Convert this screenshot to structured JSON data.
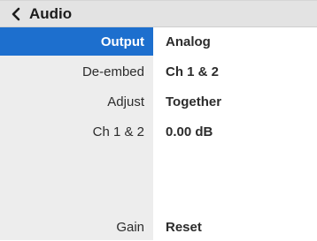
{
  "header": {
    "title": "Audio",
    "back_icon": "chevron-left-icon"
  },
  "rows": [
    {
      "label": "Output",
      "value": "Analog",
      "selected": true
    },
    {
      "label": "De-embed",
      "value": "Ch 1 & 2",
      "selected": false
    },
    {
      "label": "Adjust",
      "value": "Together",
      "selected": false
    },
    {
      "label": "Ch 1 & 2",
      "value": "0.00 dB",
      "selected": false
    },
    {
      "label": "Gain",
      "value": "Reset",
      "selected": false
    }
  ],
  "colors": {
    "selected": "#1d6fce",
    "label_column": "#ededed",
    "header": "#e3e3e3"
  }
}
